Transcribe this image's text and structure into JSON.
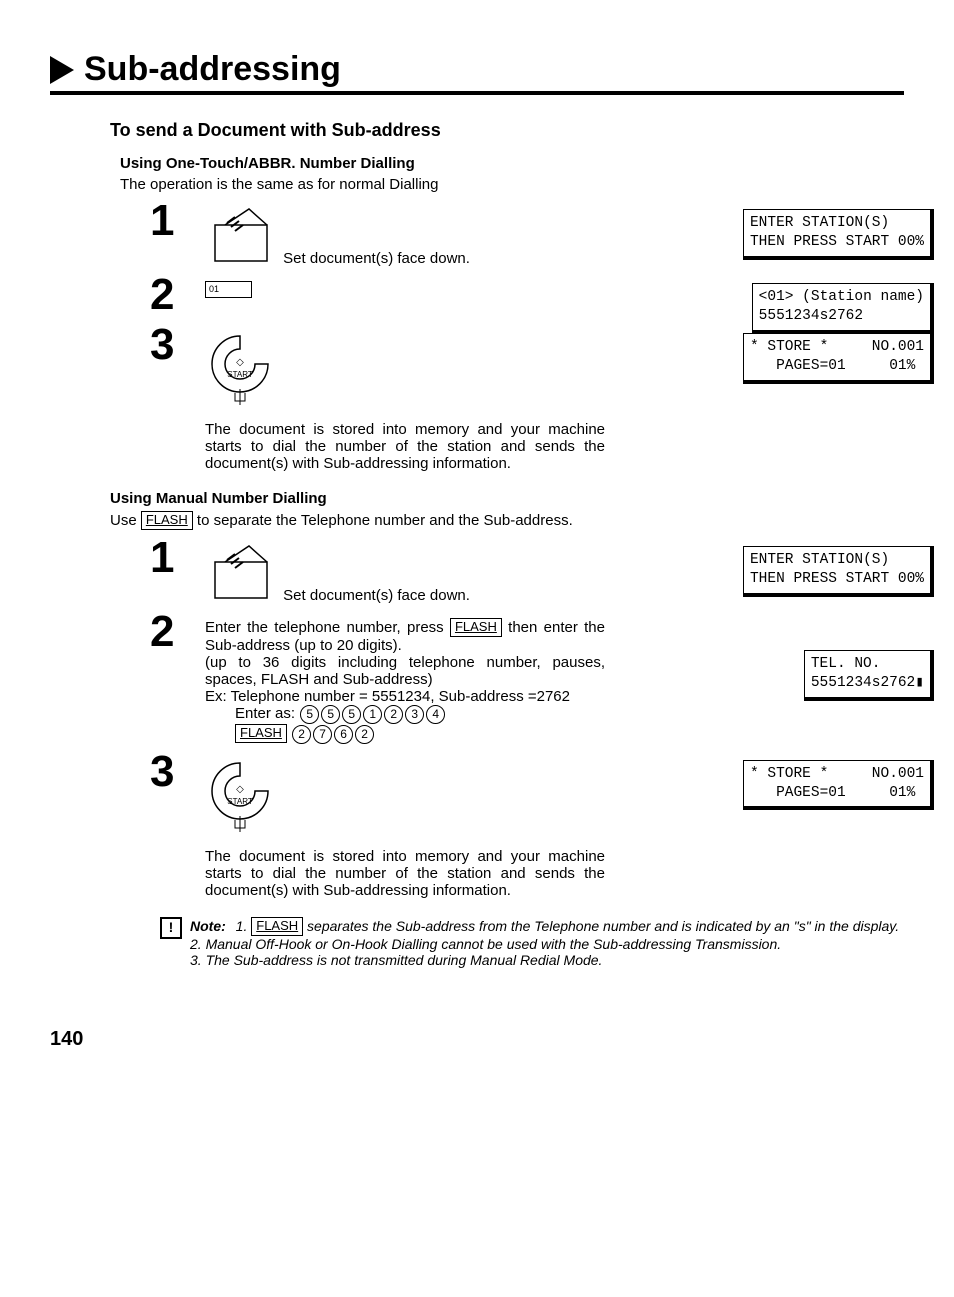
{
  "title": "Sub-addressing",
  "section1": {
    "heading": "To send a Document with Sub-address",
    "sub1": {
      "heading": "Using One-Touch/ABBR. Number Dialling",
      "intro": "The operation is the same as for normal Dialling",
      "step1_text": "Set document(s) face down.",
      "step3_text": "The document is stored into memory and your machine starts to dial the number of the station and sends the document(s) with Sub-addressing information.",
      "lcd1_l1": "ENTER STATION(S)",
      "lcd1_l2": "THEN PRESS START 00%",
      "lcd2_l1": "<01> (Station name)",
      "lcd2_l2": "5551234s2762",
      "lcd3_l1": "* STORE *     NO.001",
      "lcd3_l2": "   PAGES=01     01%"
    },
    "sub2": {
      "heading": "Using Manual Number Dialling",
      "intro_a": "Use ",
      "intro_b": " to separate the Telephone number and the Sub-address.",
      "flash_label": "FLASH",
      "step1_text": "Set document(s) face down.",
      "step2_a": "Enter the telephone number, press ",
      "step2_b": " then enter the Sub-address (up to 20 digits).",
      "step2_c": "(up to 36 digits including telephone number, pauses, spaces, FLASH and Sub-address)",
      "step2_d": "Ex: Telephone number = 5551234, Sub-address =2762",
      "step2_e": "Enter as: ",
      "step2_digits1": [
        "5",
        "5",
        "5",
        "1",
        "2",
        "3",
        "4"
      ],
      "step2_digits2": [
        "2",
        "7",
        "6",
        "2"
      ],
      "step3_text": "The document is stored into memory and your machine starts to dial the number of the station and sends the document(s) with Sub-addressing information.",
      "lcd1_l1": "ENTER STATION(S)",
      "lcd1_l2": "THEN PRESS START 00%",
      "lcd2_l1": "TEL. NO.",
      "lcd2_l2": "5551234s2762▮",
      "lcd3_l1": "* STORE *     NO.001",
      "lcd3_l2": "   PAGES=01     01%"
    }
  },
  "note": {
    "label": "Note:",
    "n1a": "1. ",
    "n1b": " separates the Sub-address from the Telephone number and is indicated by an \"s\" in the display.",
    "n2": "2. Manual Off-Hook or On-Hook Dialling cannot be used with the Sub-addressing Transmission.",
    "n3": "3. The Sub-address is not transmitted during Manual Redial Mode."
  },
  "page_number": "140",
  "icons": {
    "mini_key": "01",
    "start": "START"
  },
  "nums": {
    "one": "1",
    "two": "2",
    "three": "3",
    "excl": "!"
  }
}
